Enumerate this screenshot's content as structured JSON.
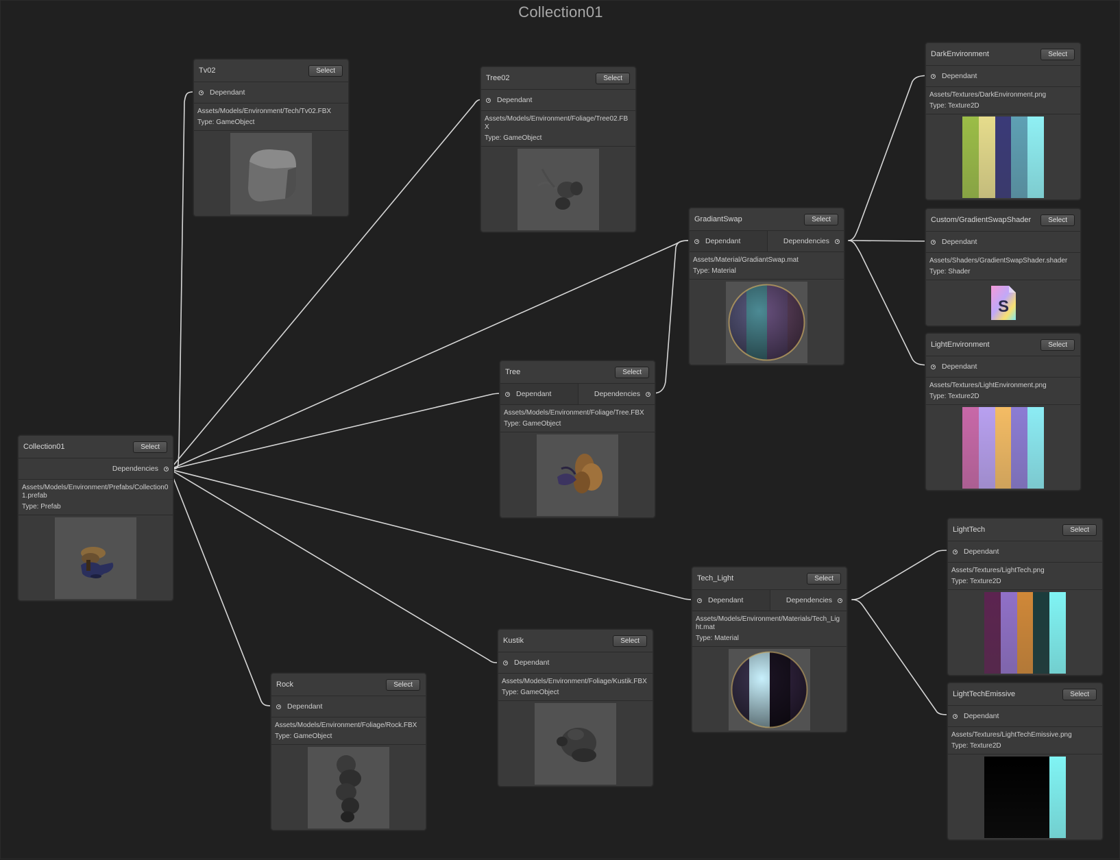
{
  "graph": {
    "title": "Collection01"
  },
  "labels": {
    "select": "Select",
    "dependant": "Dependant",
    "dependencies": "Dependencies"
  },
  "nodes": {
    "collection01": {
      "name": "Collection01",
      "path": "Assets/Models/Environment/Prefabs/Collection01.prefab",
      "type": "Type: Prefab",
      "preview_icon": "prefab-model-icon"
    },
    "tv02": {
      "name": "Tv02",
      "path": "Assets/Models/Environment/Tech/Tv02.FBX",
      "type": "Type: GameObject",
      "preview_icon": "tv-model-icon"
    },
    "tree02": {
      "name": "Tree02",
      "path": "Assets/Models/Environment/Foliage/Tree02.FBX",
      "type": "Type: GameObject",
      "preview_icon": "tree02-model-icon"
    },
    "tree": {
      "name": "Tree",
      "path": "Assets/Models/Environment/Foliage/Tree.FBX",
      "type": "Type: GameObject",
      "preview_icon": "tree-model-icon"
    },
    "rock": {
      "name": "Rock",
      "path": "Assets/Models/Environment/Foliage/Rock.FBX",
      "type": "Type: GameObject",
      "preview_icon": "rock-model-icon"
    },
    "kustik": {
      "name": "Kustik",
      "path": "Assets/Models/Environment/Foliage/Kustik.FBX",
      "type": "Type: GameObject",
      "preview_icon": "kustik-model-icon"
    },
    "gradiantswap": {
      "name": "GradiantSwap",
      "path": "Assets/Material/GradiantSwap.mat",
      "type": "Type: Material",
      "preview_icon": "material-sphere-icon"
    },
    "tech_light": {
      "name": "Tech_Light",
      "path": "Assets/Models/Environment/Materials/Tech_Light.mat",
      "type": "Type: Material",
      "preview_icon": "material-sphere-icon"
    },
    "darkenvironment": {
      "name": "DarkEnvironment",
      "path": "Assets/Textures/DarkEnvironment.png",
      "type": "Type: Texture2D",
      "preview_icon": "texture-stripes-icon",
      "colors": [
        "#9bbd47",
        "#e6dc8c",
        "#3a3a78",
        "#5ea0b4",
        "#8ff0f4"
      ]
    },
    "gradientswapshader": {
      "name": "Custom/GradientSwapShader",
      "path": "Assets/Shaders/GradientSwapShader.shader",
      "type": "Type: Shader",
      "preview_icon": "shader-file-icon"
    },
    "lightenvironment": {
      "name": "LightEnvironment",
      "path": "Assets/Textures/LightEnvironment.png",
      "type": "Type: Texture2D",
      "preview_icon": "texture-stripes-icon",
      "colors": [
        "#c868a8",
        "#b8a0f0",
        "#f4bc64",
        "#8c7cd4",
        "#8cecf4"
      ]
    },
    "lighttech": {
      "name": "LightTech",
      "path": "Assets/Textures/LightTech.png",
      "type": "Type: Texture2D",
      "preview_icon": "texture-stripes-icon",
      "colors": [
        "#5c2450",
        "#9070c8",
        "#d08838",
        "#1c3c3c",
        "#80f4f4"
      ]
    },
    "lighttechemissive": {
      "name": "LightTechEmissive",
      "path": "Assets/Textures/LightTechEmissive.png",
      "type": "Type: Texture2D",
      "preview_icon": "texture-stripes-icon",
      "colors": [
        "#000000",
        "#000000",
        "#000000",
        "#000000",
        "#80f4f4"
      ]
    }
  }
}
